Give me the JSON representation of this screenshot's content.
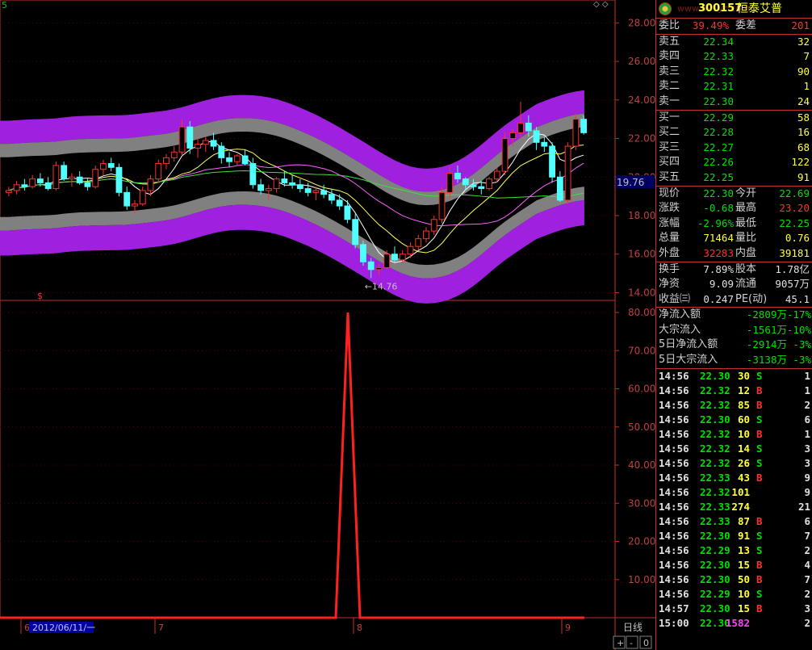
{
  "header": {
    "code": "300157",
    "name": "恒泰艾普",
    "watermark": "www.591yc.com",
    "corner": "5"
  },
  "price_axis": {
    "labels": [
      "28.00",
      "26.00",
      "24.00",
      "22.00",
      "20.00",
      "18.00",
      "16.00",
      "14.00"
    ],
    "current_tag": "19.76",
    "low_label": "14.76",
    "marker": "$"
  },
  "indicator_axis": {
    "labels": [
      "80.00",
      "70.00",
      "60.00",
      "50.00",
      "40.00",
      "30.00",
      "20.00",
      "10.00"
    ]
  },
  "time_axis": {
    "labels": [
      "6",
      "2012/06/11/一",
      "7",
      "8",
      "9"
    ],
    "period": "日线",
    "plus": "+",
    "minus": "-",
    "zero": "0"
  },
  "order_ratio": {
    "label1": "委比",
    "value1": "39.49%",
    "label2": "委差",
    "value2": "201"
  },
  "asks": [
    {
      "label": "卖五",
      "price": "22.34",
      "vol": "32"
    },
    {
      "label": "卖四",
      "price": "22.33",
      "vol": "7"
    },
    {
      "label": "卖三",
      "price": "22.32",
      "vol": "90"
    },
    {
      "label": "卖二",
      "price": "22.31",
      "vol": "1"
    },
    {
      "label": "卖一",
      "price": "22.30",
      "vol": "24"
    }
  ],
  "bids": [
    {
      "label": "买一",
      "price": "22.29",
      "vol": "58"
    },
    {
      "label": "买二",
      "price": "22.28",
      "vol": "16"
    },
    {
      "label": "买三",
      "price": "22.27",
      "vol": "68"
    },
    {
      "label": "买四",
      "price": "22.26",
      "vol": "122"
    },
    {
      "label": "买五",
      "price": "22.25",
      "vol": "91"
    }
  ],
  "quote": [
    {
      "l1": "现价",
      "v1": "22.30",
      "c1": "green",
      "l2": "今开",
      "v2": "22.69",
      "c2": "green"
    },
    {
      "l1": "涨跌",
      "v1": "-0.68",
      "c1": "green",
      "l2": "最高",
      "v2": "23.20",
      "c2": "red"
    },
    {
      "l1": "涨幅",
      "v1": "-2.96%",
      "c1": "green",
      "l2": "最低",
      "v2": "22.25",
      "c2": "green"
    },
    {
      "l1": "总量",
      "v1": "71464",
      "c1": "yellow",
      "l2": "量比",
      "v2": "0.76",
      "c2": "yellow"
    },
    {
      "l1": "外盘",
      "v1": "32283",
      "c1": "red",
      "l2": "内盘",
      "v2": "39181",
      "c2": "yellow"
    }
  ],
  "fundamentals": [
    {
      "l1": "换手",
      "v1": "7.89%",
      "l2": "股本",
      "v2": "1.78亿"
    },
    {
      "l1": "净资",
      "v1": "9.09",
      "l2": "流通",
      "v2": "9057万"
    },
    {
      "l1": "收益㈢",
      "v1": "0.247",
      "l2": "PE(动)",
      "v2": "45.1"
    }
  ],
  "flows": [
    {
      "label": "净流入额",
      "value": "-2809万",
      "pct": "-17%"
    },
    {
      "label": "大宗流入",
      "value": "-1561万",
      "pct": "-10%"
    },
    {
      "label": "5日净流入额",
      "value": "-2914万",
      "pct": "-3%"
    },
    {
      "label": "5日大宗流入",
      "value": "-3138万",
      "pct": "-3%"
    }
  ],
  "trades": [
    {
      "time": "14:56",
      "price": "22.30",
      "pc": "green",
      "vol": "30",
      "vc": "yellow",
      "side": "S",
      "sc": "green",
      "n": "1"
    },
    {
      "time": "14:56",
      "price": "22.32",
      "pc": "green",
      "vol": "12",
      "vc": "yellow",
      "side": "B",
      "sc": "red",
      "n": "1"
    },
    {
      "time": "14:56",
      "price": "22.32",
      "pc": "green",
      "vol": "85",
      "vc": "yellow",
      "side": "B",
      "sc": "red",
      "n": "2"
    },
    {
      "time": "14:56",
      "price": "22.30",
      "pc": "green",
      "vol": "60",
      "vc": "yellow",
      "side": "S",
      "sc": "green",
      "n": "6"
    },
    {
      "time": "14:56",
      "price": "22.32",
      "pc": "green",
      "vol": "10",
      "vc": "yellow",
      "side": "B",
      "sc": "red",
      "n": "1"
    },
    {
      "time": "14:56",
      "price": "22.32",
      "pc": "green",
      "vol": "14",
      "vc": "yellow",
      "side": "S",
      "sc": "green",
      "n": "3"
    },
    {
      "time": "14:56",
      "price": "22.32",
      "pc": "green",
      "vol": "26",
      "vc": "yellow",
      "side": "S",
      "sc": "green",
      "n": "3"
    },
    {
      "time": "14:56",
      "price": "22.33",
      "pc": "green",
      "vol": "43",
      "vc": "yellow",
      "side": "B",
      "sc": "red",
      "n": "9"
    },
    {
      "time": "14:56",
      "price": "22.32",
      "pc": "green",
      "vol": "101",
      "vc": "yellow",
      "side": "",
      "sc": "red",
      "n": "9"
    },
    {
      "time": "14:56",
      "price": "22.33",
      "pc": "green",
      "vol": "274",
      "vc": "yellow",
      "side": "",
      "sc": "red",
      "n": "21"
    },
    {
      "time": "14:56",
      "price": "22.33",
      "pc": "green",
      "vol": "87",
      "vc": "yellow",
      "side": "B",
      "sc": "red",
      "n": "6"
    },
    {
      "time": "14:56",
      "price": "22.30",
      "pc": "green",
      "vol": "91",
      "vc": "yellow",
      "side": "S",
      "sc": "green",
      "n": "7"
    },
    {
      "time": "14:56",
      "price": "22.29",
      "pc": "green",
      "vol": "13",
      "vc": "yellow",
      "side": "S",
      "sc": "green",
      "n": "2"
    },
    {
      "time": "14:56",
      "price": "22.30",
      "pc": "green",
      "vol": "15",
      "vc": "yellow",
      "side": "B",
      "sc": "red",
      "n": "4"
    },
    {
      "time": "14:56",
      "price": "22.30",
      "pc": "green",
      "vol": "50",
      "vc": "yellow",
      "side": "B",
      "sc": "red",
      "n": "7"
    },
    {
      "time": "14:56",
      "price": "22.29",
      "pc": "green",
      "vol": "10",
      "vc": "yellow",
      "side": "S",
      "sc": "green",
      "n": "2"
    },
    {
      "time": "14:57",
      "price": "22.30",
      "pc": "green",
      "vol": "15",
      "vc": "yellow",
      "side": "B",
      "sc": "red",
      "n": "3"
    },
    {
      "time": "15:00",
      "price": "22.30",
      "pc": "green",
      "vol": "1582",
      "vc": "magenta",
      "side": "",
      "sc": "red",
      "n": "2"
    }
  ],
  "chart_data": {
    "type": "candlestick",
    "price_range": [
      14,
      28.5
    ],
    "indicator_range": [
      0,
      80
    ],
    "candles": [
      [
        19.2,
        19.5,
        19.0,
        19.3
      ],
      [
        19.3,
        19.8,
        19.1,
        19.6
      ],
      [
        19.6,
        19.9,
        19.3,
        19.5
      ],
      [
        19.5,
        20.1,
        19.4,
        19.9
      ],
      [
        19.9,
        20.2,
        19.5,
        19.7
      ],
      [
        19.7,
        20.0,
        19.3,
        19.4
      ],
      [
        19.4,
        20.8,
        19.3,
        20.6
      ],
      [
        20.6,
        20.8,
        19.8,
        19.9
      ],
      [
        19.9,
        20.2,
        19.5,
        20.0
      ],
      [
        20.0,
        20.3,
        19.6,
        19.7
      ],
      [
        19.7,
        19.9,
        19.3,
        19.5
      ],
      [
        19.5,
        20.6,
        19.4,
        20.4
      ],
      [
        20.4,
        20.9,
        20.1,
        20.7
      ],
      [
        20.7,
        21.0,
        20.3,
        20.5
      ],
      [
        20.5,
        20.7,
        19.0,
        19.2
      ],
      [
        19.2,
        19.5,
        18.3,
        18.5
      ],
      [
        18.5,
        18.8,
        18.1,
        18.6
      ],
      [
        18.6,
        19.5,
        18.5,
        19.3
      ],
      [
        19.3,
        20.1,
        19.0,
        19.9
      ],
      [
        19.9,
        20.9,
        19.7,
        20.7
      ],
      [
        20.7,
        21.2,
        20.4,
        21.0
      ],
      [
        21.0,
        21.6,
        20.8,
        21.3
      ],
      [
        21.3,
        23.0,
        21.1,
        22.6
      ],
      [
        22.6,
        22.9,
        21.2,
        21.5
      ],
      [
        21.5,
        22.0,
        21.0,
        21.7
      ],
      [
        21.7,
        22.1,
        21.3,
        21.9
      ],
      [
        21.9,
        22.3,
        21.4,
        21.6
      ],
      [
        21.6,
        21.8,
        20.7,
        21.0
      ],
      [
        21.0,
        21.3,
        20.5,
        20.8
      ],
      [
        20.8,
        21.2,
        20.6,
        21.1
      ],
      [
        21.1,
        21.4,
        20.6,
        20.7
      ],
      [
        20.7,
        21.0,
        19.4,
        19.6
      ],
      [
        19.6,
        19.9,
        19.1,
        19.3
      ],
      [
        19.3,
        19.6,
        18.8,
        19.4
      ],
      [
        19.4,
        20.0,
        19.2,
        19.9
      ],
      [
        19.9,
        20.3,
        19.5,
        19.7
      ],
      [
        19.7,
        20.1,
        19.4,
        19.6
      ],
      [
        19.6,
        19.9,
        19.2,
        19.4
      ],
      [
        19.4,
        19.7,
        19.0,
        19.2
      ],
      [
        19.2,
        19.5,
        18.8,
        19.3
      ],
      [
        19.3,
        19.6,
        18.9,
        19.1
      ],
      [
        19.1,
        19.4,
        18.6,
        18.8
      ],
      [
        18.8,
        19.1,
        18.3,
        18.5
      ],
      [
        18.5,
        18.8,
        17.6,
        17.8
      ],
      [
        17.8,
        18.1,
        16.3,
        16.5
      ],
      [
        16.5,
        16.7,
        15.4,
        15.6
      ],
      [
        15.6,
        15.8,
        14.76,
        15.2
      ],
      [
        15.2,
        15.5,
        14.9,
        15.3
      ],
      [
        15.3,
        16.2,
        15.2,
        16.0
      ],
      [
        16.0,
        16.4,
        15.6,
        15.7
      ],
      [
        15.7,
        16.2,
        15.5,
        16.0
      ],
      [
        16.0,
        16.6,
        15.8,
        16.4
      ],
      [
        16.4,
        17.0,
        16.2,
        16.8
      ],
      [
        16.8,
        17.4,
        16.6,
        17.2
      ],
      [
        17.2,
        18.0,
        17.0,
        17.8
      ],
      [
        17.8,
        19.5,
        17.6,
        19.2
      ],
      [
        19.2,
        20.5,
        18.9,
        20.2
      ],
      [
        20.2,
        20.6,
        19.7,
        19.9
      ],
      [
        19.9,
        20.0,
        19.3,
        19.6
      ],
      [
        19.6,
        19.9,
        19.3,
        19.5
      ],
      [
        19.5,
        19.8,
        19.1,
        19.4
      ],
      [
        19.4,
        20.0,
        19.3,
        19.9
      ],
      [
        19.9,
        20.5,
        19.7,
        20.3
      ],
      [
        20.3,
        22.3,
        20.1,
        22.0
      ],
      [
        22.0,
        22.5,
        21.6,
        22.3
      ],
      [
        22.3,
        23.9,
        22.0,
        22.8
      ],
      [
        22.8,
        23.2,
        22.1,
        22.4
      ],
      [
        22.4,
        22.6,
        21.4,
        21.8
      ],
      [
        21.8,
        22.1,
        21.3,
        21.6
      ],
      [
        21.6,
        21.8,
        19.7,
        20.0
      ],
      [
        20.0,
        20.3,
        18.7,
        18.8
      ],
      [
        18.8,
        21.8,
        18.6,
        21.6
      ],
      [
        21.6,
        23.3,
        21.4,
        23.0
      ],
      [
        23.0,
        23.2,
        22.2,
        22.3
      ]
    ],
    "indicator_peak": {
      "x_label": "8",
      "value": 80
    }
  }
}
